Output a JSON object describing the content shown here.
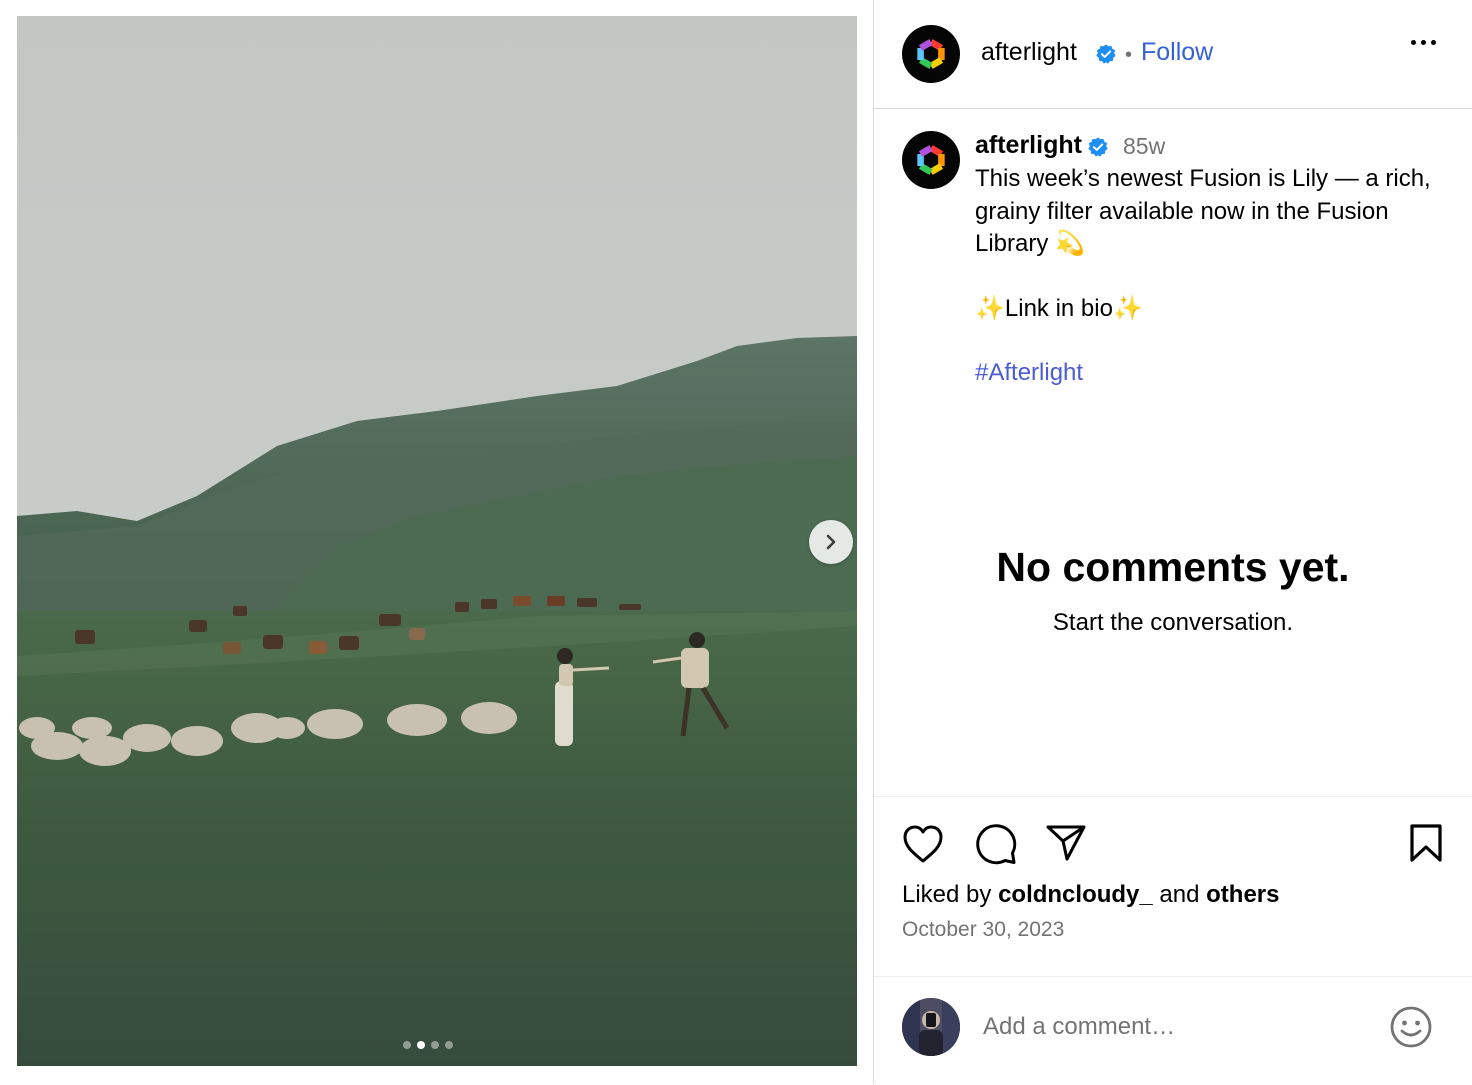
{
  "post": {
    "account": "afterlight",
    "verified": true,
    "follow_label": "Follow",
    "time_ago": "85w",
    "caption": "This week’s newest Fusion is Lily — a rich, grainy filter available now in the Fusion Library 💫",
    "caption_line2": "✨Link in bio✨",
    "hashtag": "#Afterlight",
    "carousel": {
      "count": 4,
      "active_index": 1
    }
  },
  "comments": {
    "empty_title": "No comments yet.",
    "empty_subtitle": "Start the conversation."
  },
  "engagement": {
    "liked_prefix": "Liked by",
    "liked_user": "coldncloudy_",
    "liked_and": "and",
    "liked_others": "others",
    "date": "October 30, 2023"
  },
  "composer": {
    "placeholder": "Add a comment…"
  },
  "icons": [
    "more-options-icon",
    "heart-icon",
    "comment-icon",
    "share-icon",
    "bookmark-icon",
    "emoji-icon",
    "chevron-right-icon",
    "verified-icon"
  ],
  "colors": {
    "follow": "#3560d6",
    "hashtag": "#4a5cd6",
    "verified": "#1e8ff2",
    "muted": "#737373"
  }
}
